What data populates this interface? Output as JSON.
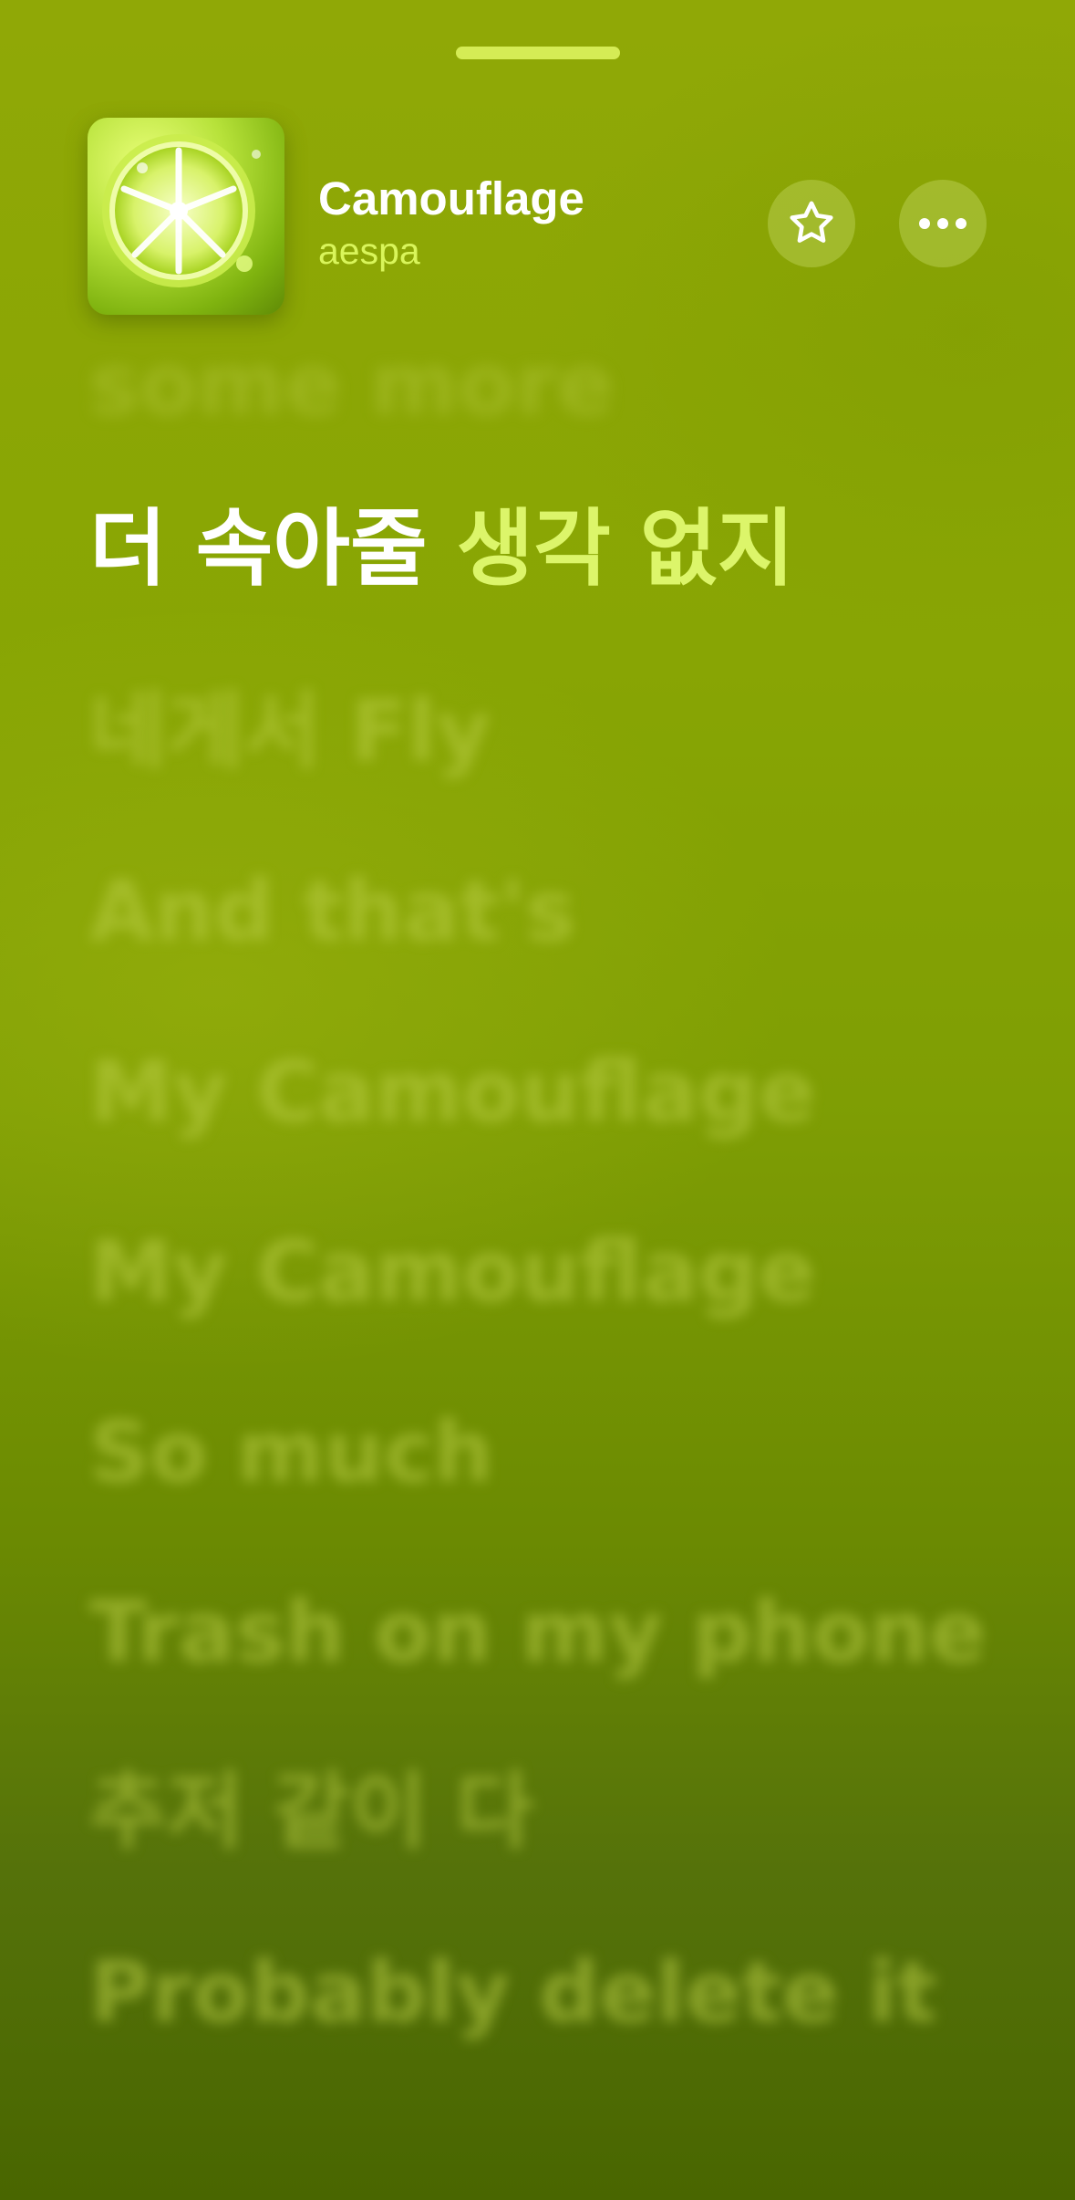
{
  "now_playing": {
    "title": "Camouflage",
    "artist": "aespa",
    "artwork_icon": "lime-slice-artwork",
    "favorite_icon": "star-outline-icon",
    "more_icon": "ellipsis-icon"
  },
  "lyrics": {
    "previous_line": "some more",
    "current_line": {
      "sung": "더 속아줄 ",
      "upcoming": "생각 없지"
    },
    "next_lines": [
      "네게서 Fly",
      "And that's",
      "My Camouflage",
      "My Camouflage",
      "So much",
      "Trash on my phone",
      "추저 같이 다",
      "Probably delete it"
    ]
  },
  "colors": {
    "accent": "#d9f55a",
    "background_top": "#90a806",
    "background_bottom": "#496600"
  }
}
